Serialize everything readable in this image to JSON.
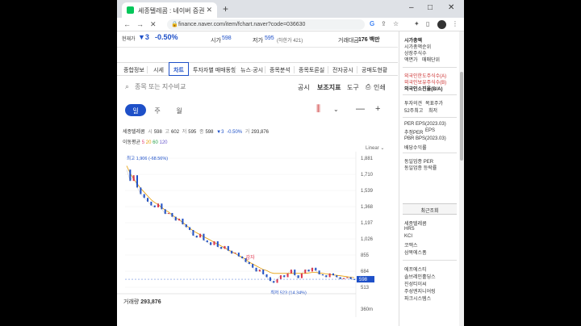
{
  "browser": {
    "tab_title": "세종텔레콤 : 네이버 증권",
    "url": "finance.naver.com/item/fchart.naver?code=036630",
    "window_controls": [
      "–",
      "□",
      "✕"
    ]
  },
  "header": {
    "mini_name": "현재가",
    "mini_change": "▼3",
    "mini_rate": "-0.50%",
    "open_label": "시가",
    "open_value": "598",
    "low_label": "저가",
    "low_value": "595",
    "low_limit": "(하한가 421)",
    "amount_label": "거래대금",
    "amount_value": "176 백만"
  },
  "tabs": [
    {
      "label": "종합정보"
    },
    {
      "label": "시세"
    },
    {
      "label": "차트"
    },
    {
      "label": "투자자별 매매동향"
    },
    {
      "label": "뉴스·공시"
    },
    {
      "label": "종목분석"
    },
    {
      "label": "종목토론실"
    },
    {
      "label": "전자공시"
    },
    {
      "label": "공매도현황"
    }
  ],
  "search": {
    "placeholder": "종목 또는 지수비교",
    "options": [
      "공시",
      "보조지표",
      "도구",
      "인쇄"
    ]
  },
  "periods": [
    "일",
    "주",
    "월"
  ],
  "info": {
    "name": "세종텔레콤",
    "open_label": "시",
    "open": "598",
    "high_label": "고",
    "high": "602",
    "low_label": "저",
    "low": "595",
    "close_label": "종",
    "close": "598",
    "change": "▼3",
    "rate": "-0.50%",
    "volume_label": "거",
    "volume": "293,876",
    "ma_label": "이동평균",
    "ma": [
      "5",
      "20",
      "60",
      "120"
    ],
    "scale": "Linear"
  },
  "chart_data": {
    "type": "line",
    "title": "",
    "y_ticks": [
      "1,881",
      "1,710",
      "1,539",
      "1,368",
      "1,197",
      "1,026",
      "855",
      "684",
      "513"
    ],
    "ylim": [
      513,
      1881
    ],
    "high_label": "최고 1,906 (-68.56%)",
    "low_label": "최저 523 (14.34%)",
    "current_price": "598",
    "annotation": "감자",
    "volume_label": "거래량",
    "volume_value": "293,876",
    "volume_axis": "360m",
    "price_series": [
      1760,
      1640,
      1700,
      1570,
      1500,
      1460,
      1420,
      1380,
      1360,
      1400,
      1340,
      1290,
      1300,
      1260,
      1220,
      1240,
      1180,
      1150,
      1120,
      1060,
      1040,
      1080,
      1010,
      990,
      960,
      1000,
      940,
      920,
      950,
      900,
      870,
      880,
      840,
      820,
      780,
      760,
      720,
      680,
      700,
      650,
      620,
      580,
      560,
      600,
      640,
      620,
      660,
      700,
      640,
      610,
      660,
      700,
      680,
      720,
      690,
      650,
      640,
      620,
      660,
      640,
      620,
      600,
      610,
      620,
      600,
      598
    ],
    "ma_series": [
      1800,
      1720,
      1660,
      1610,
      1560,
      1520,
      1480,
      1440,
      1410,
      1390,
      1360,
      1330,
      1310,
      1280,
      1250,
      1230,
      1200,
      1170,
      1140,
      1110,
      1090,
      1070,
      1050,
      1030,
      1010,
      990,
      970,
      950,
      930,
      910,
      890,
      870,
      850,
      830,
      810,
      780,
      760,
      740,
      720,
      700,
      690,
      670,
      660,
      660,
      660,
      660,
      660,
      660,
      660,
      660,
      660,
      660,
      665,
      670,
      670,
      665,
      660,
      655,
      650,
      645,
      640,
      635,
      630,
      625,
      620,
      615
    ]
  },
  "sidebar": {
    "lines1": [
      "시가총액",
      "시가총액순위",
      "상장주식수",
      "액면가",
      "매매단위"
    ],
    "lines2": [
      "외국인한도주식수(A)",
      "외국인보유주식수(B)",
      "외국인소진율(B/A)"
    ],
    "lines3": [
      "투자의견",
      "목표주가",
      "52주최고",
      "최저"
    ],
    "lines4": [
      "PER",
      "EPS(2023.03)",
      "추정PER",
      "EPS",
      "PBR",
      "BPS(2023.03)",
      "배당수익률"
    ],
    "lines5": [
      "동일업종 PER",
      "동일업종 등락률"
    ],
    "recent_title": "최근조회",
    "recent": [
      "세종텔레콤",
      "HRS",
      "KCI",
      "코맥스",
      "삼목에스폼"
    ],
    "popular": [
      "에프에스티",
      "솔브레인홀딩스",
      "진성티이씨",
      "주성엔지니어링",
      "파크시스템스"
    ]
  }
}
